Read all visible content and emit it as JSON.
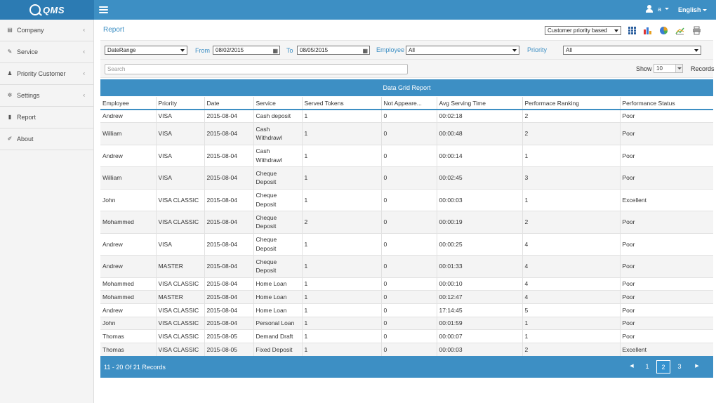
{
  "app": {
    "brand": "QMS"
  },
  "topbar": {
    "user": "a",
    "language": "English"
  },
  "sidebar": {
    "items": [
      {
        "label": "Company",
        "icon": "building-icon",
        "has_sub": true
      },
      {
        "label": "Service",
        "icon": "wrench-icon",
        "has_sub": true
      },
      {
        "label": "Priority Customer",
        "icon": "users-icon",
        "has_sub": true
      },
      {
        "label": "Settings",
        "icon": "gear-icon",
        "has_sub": true
      },
      {
        "label": "Report",
        "icon": "file-icon",
        "has_sub": false
      },
      {
        "label": "About",
        "icon": "edit-icon",
        "has_sub": false
      }
    ]
  },
  "main": {
    "title": "Report",
    "report_type": "Customer priority based",
    "tools": [
      "grid-icon",
      "bar-chart-icon",
      "pie-chart-icon",
      "line-chart-icon",
      "print-icon"
    ]
  },
  "filters": {
    "range_select": "DateRange",
    "from_label": "From",
    "from_value": "08/02/2015",
    "to_label": "To",
    "to_value": "08/05/2015",
    "employee_label": "Employee",
    "employee_value": "All",
    "priority_label": "Priority",
    "priority_value": "All"
  },
  "search": {
    "placeholder": "Search",
    "show_label": "Show",
    "page_size": "10",
    "records_label": "Records"
  },
  "grid": {
    "title": "Data Grid Report",
    "columns": [
      "Employee",
      "Priority",
      "Date",
      "Service",
      "Served Tokens",
      "Not Appeare...",
      "Avg Serving Time",
      "Performace Ranking",
      "Performance Status"
    ],
    "rows": [
      [
        "Andrew",
        "VISA",
        "2015-08-04",
        "Cash deposit",
        "1",
        "0",
        "00:02:18",
        "2",
        "Poor"
      ],
      [
        "William",
        "VISA",
        "2015-08-04",
        "Cash Withdrawl",
        "1",
        "0",
        "00:00:48",
        "2",
        "Poor"
      ],
      [
        "Andrew",
        "VISA",
        "2015-08-04",
        "Cash Withdrawl",
        "1",
        "0",
        "00:00:14",
        "1",
        "Poor"
      ],
      [
        "William",
        "VISA",
        "2015-08-04",
        "Cheque Deposit",
        "1",
        "0",
        "00:02:45",
        "3",
        "Poor"
      ],
      [
        "John",
        "VISA CLASSIC",
        "2015-08-04",
        "Cheque Deposit",
        "1",
        "0",
        "00:00:03",
        "1",
        "Excellent"
      ],
      [
        "Mohammed",
        "VISA CLASSIC",
        "2015-08-04",
        "Cheque Deposit",
        "2",
        "0",
        "00:00:19",
        "2",
        "Poor"
      ],
      [
        "Andrew",
        "VISA",
        "2015-08-04",
        "Cheque Deposit",
        "1",
        "0",
        "00:00:25",
        "4",
        "Poor"
      ],
      [
        "Andrew",
        "MASTER",
        "2015-08-04",
        "Cheque Deposit",
        "1",
        "0",
        "00:01:33",
        "4",
        "Poor"
      ],
      [
        "Mohammed",
        "VISA CLASSIC",
        "2015-08-04",
        "Home Loan",
        "1",
        "0",
        "00:00:10",
        "4",
        "Poor"
      ],
      [
        "Mohammed",
        "MASTER",
        "2015-08-04",
        "Home Loan",
        "1",
        "0",
        "00:12:47",
        "4",
        "Poor"
      ],
      [
        "Andrew",
        "VISA CLASSIC",
        "2015-08-04",
        "Home Loan",
        "1",
        "0",
        "17:14:45",
        "5",
        "Poor"
      ],
      [
        "John",
        "VISA CLASSIC",
        "2015-08-04",
        "Personal Loan",
        "1",
        "0",
        "00:01:59",
        "1",
        "Poor"
      ],
      [
        "Thomas",
        "VISA CLASSIC",
        "2015-08-05",
        "Demand Draft",
        "1",
        "0",
        "00:00:07",
        "1",
        "Poor"
      ],
      [
        "Thomas",
        "VISA CLASSIC",
        "2015-08-05",
        "Fixed Deposit",
        "1",
        "0",
        "00:00:03",
        "2",
        "Excellent"
      ]
    ],
    "footer": "11 - 20 Of 21 Records",
    "pages": [
      "1",
      "2",
      "3"
    ],
    "active_page": "2"
  },
  "colors": {
    "primary": "#3d8fc4",
    "brand_dark": "#2c7bb3"
  }
}
